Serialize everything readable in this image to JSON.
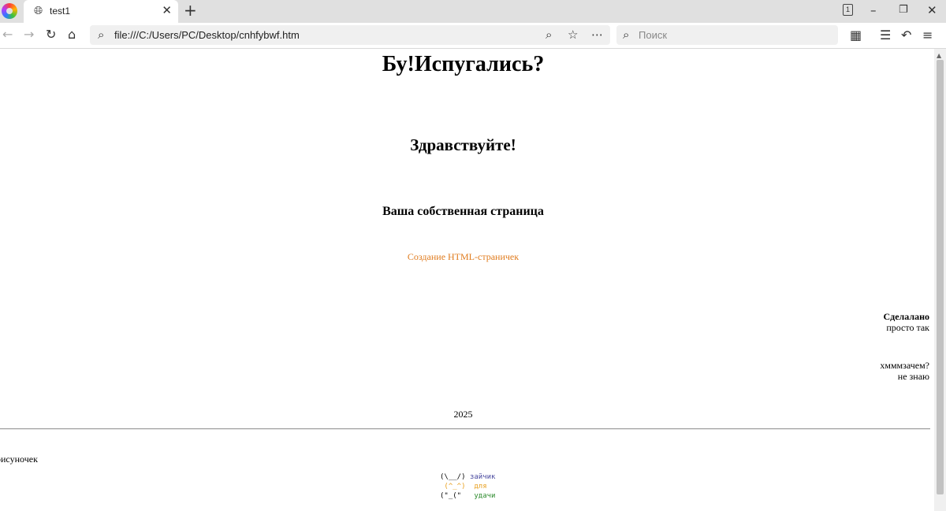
{
  "tab": {
    "title": "test1"
  },
  "address": {
    "url": "file:///C:/Users/PC/Desktop/cnhfybwf.htm"
  },
  "search": {
    "placeholder": "Поиск"
  },
  "toolbar": {
    "tab_count": "1"
  },
  "page": {
    "h1": "Бу!Испугались?",
    "h2": "Здравствуйте!",
    "h3": "Ваша собственная страница",
    "link": "Создание HTML-страничек",
    "side1": {
      "line1": "Сделалано",
      "line2": "просто так"
    },
    "side2": {
      "line1": "хмммзачем?",
      "line2": "не знаю"
    },
    "year": "2025",
    "pictures_label": "рисуночек",
    "bunny": [
      {
        "art": "(\\__/)",
        "word": "зайчик",
        "color": "#4a4aa0"
      },
      {
        "art": " (^_^)",
        "word": " для",
        "color": "#e8a020"
      },
      {
        "art": "(\"_(\"",
        "word": "  удачи",
        "color": "#2e8b2e"
      }
    ]
  },
  "colors": {
    "link": "#e07b1d"
  }
}
